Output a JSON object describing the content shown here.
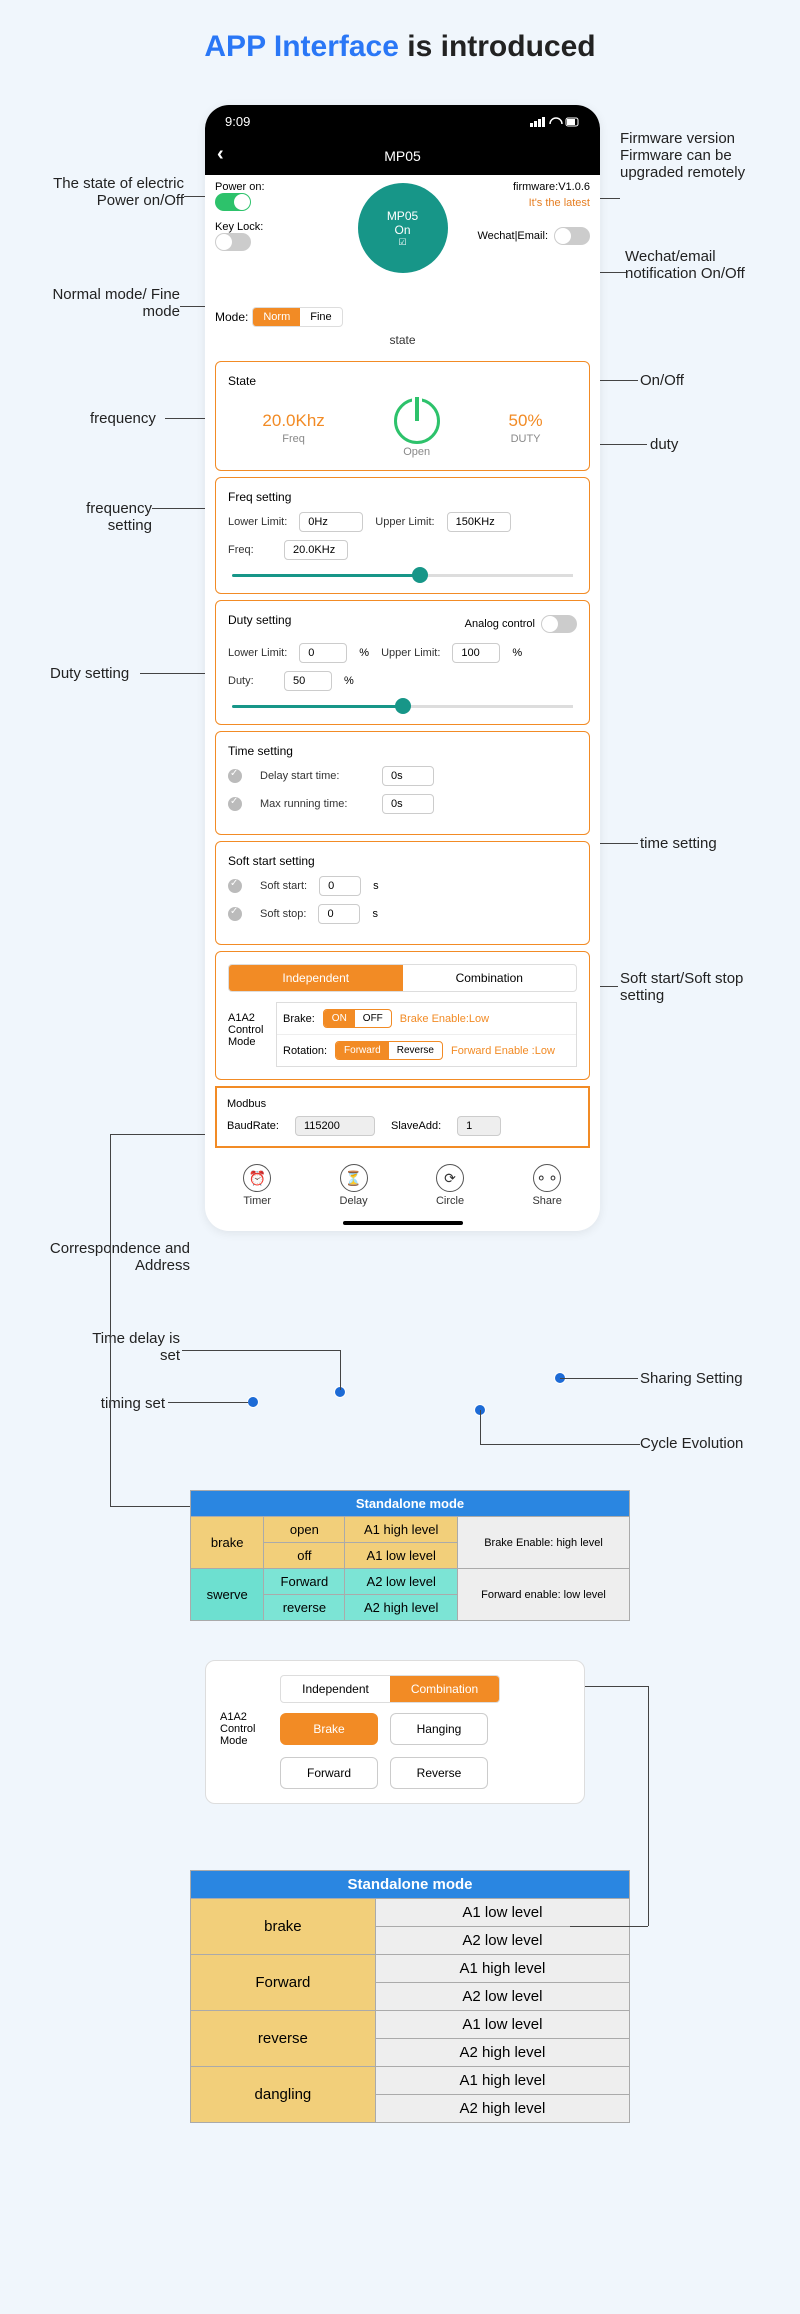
{
  "title_blue": "APP Interface",
  "title_black": " is introduced",
  "status": {
    "time": "9:09"
  },
  "header": {
    "title": "MP05"
  },
  "top": {
    "power_lbl": "Power on:",
    "keylock_lbl": "Key Lock:",
    "firmware_lbl": "firmware:V1.0.6",
    "latest": "It's the latest",
    "wechat_lbl": "Wechat|Email:",
    "badge_title": "MP05",
    "badge_state": "On"
  },
  "mode": {
    "lbl": "Mode:",
    "norm": "Norm",
    "fine": "Fine"
  },
  "subheader": "state",
  "state": {
    "title": "State",
    "freq_val": "20.0Khz",
    "freq_lbl": "Freq",
    "open_lbl": "Open",
    "duty_val": "50%",
    "duty_lbl": "DUTY"
  },
  "freq": {
    "title": "Freq setting",
    "lower_lbl": "Lower Limit:",
    "lower_val": "0Hz",
    "upper_lbl": "Upper Limit:",
    "upper_val": "150KHz",
    "freq_lbl": "Freq:",
    "freq_val": "20.0KHz",
    "slider_pct": 55
  },
  "duty": {
    "title": "Duty setting",
    "analog_lbl": "Analog control",
    "lower_lbl": "Lower Limit:",
    "lower_val": "0",
    "upper_lbl": "Upper Limit:",
    "upper_val": "100",
    "pct": "%",
    "duty_lbl": "Duty:",
    "duty_val": "50",
    "slider_pct": 50
  },
  "time": {
    "title": "Time setting",
    "delay_lbl": "Delay start time:",
    "delay_val": "0s",
    "max_lbl": "Max running time:",
    "max_val": "0s"
  },
  "soft": {
    "title": "Soft start setting",
    "start_lbl": "Soft start:",
    "start_val": "0",
    "unit": "s",
    "stop_lbl": "Soft stop:",
    "stop_val": "0"
  },
  "control": {
    "tab1": "Independent",
    "tab2": "Combination",
    "mode_lbl": "A1A2 Control Mode",
    "brake_lbl": "Brake:",
    "on": "ON",
    "off": "OFF",
    "brake_hint": "Brake Enable:Low",
    "rot_lbl": "Rotation:",
    "fwd": "Forward",
    "rev": "Reverse",
    "rot_hint": "Forward Enable :Low"
  },
  "modbus": {
    "title": "Modbus",
    "baud_lbl": "BaudRate:",
    "baud_val": "115200",
    "slave_lbl": "SlaveAdd:",
    "slave_val": "1"
  },
  "bottom": {
    "timer": "Timer",
    "delay": "Delay",
    "circle": "Circle",
    "share": "Share"
  },
  "annot": {
    "power_state": "The state of electric Power on/Off",
    "normal_fine": "Normal mode/ Fine mode",
    "frequency": "frequency",
    "freq_setting": "frequency setting",
    "duty_setting": "Duty setting",
    "corr_addr": "Correspondence and Address",
    "time_delay": "Time delay is set",
    "timing_set": "timing set",
    "firmware": "Firmware version Firmware can be upgraded remotely",
    "wechat": "Wechat/email notification On/Off",
    "onoff": "On/Off",
    "duty": "duty",
    "time_setting": "time setting",
    "soft": "Soft start/Soft stop setting",
    "sharing": "Sharing Setting",
    "cycle": "Cycle Evolution"
  },
  "table1": {
    "hdr": "Standalone mode",
    "rows": [
      {
        "lab": "brake",
        "c1": "open",
        "c2": "A1 high level",
        "r": "Brake Enable: high level"
      },
      {
        "lab": "",
        "c1": "off",
        "c2": "A1 low level",
        "r": ""
      },
      {
        "lab": "swerve",
        "c1": "Forward",
        "c2": "A2 low level",
        "r": "Forward enable: low level"
      },
      {
        "lab": "",
        "c1": "reverse",
        "c2": "A2 high level",
        "r": ""
      }
    ]
  },
  "mini": {
    "mode_lbl": "A1A2 Control Mode",
    "tab1": "Independent",
    "tab2": "Combination",
    "b1": "Brake",
    "b2": "Hanging",
    "b3": "Forward",
    "b4": "Reverse"
  },
  "table2": {
    "hdr": "Standalone mode",
    "rows": [
      {
        "lab": "brake",
        "c": "A1 low level"
      },
      {
        "lab": "",
        "c": "A2 low level"
      },
      {
        "lab": "Forward",
        "c": "A1 high level"
      },
      {
        "lab": "",
        "c": "A2 low level"
      },
      {
        "lab": "reverse",
        "c": "A1 low level"
      },
      {
        "lab": "",
        "c": "A2 high level"
      },
      {
        "lab": "dangling",
        "c": "A1 high level"
      },
      {
        "lab": "",
        "c": "A2 high level"
      }
    ]
  }
}
